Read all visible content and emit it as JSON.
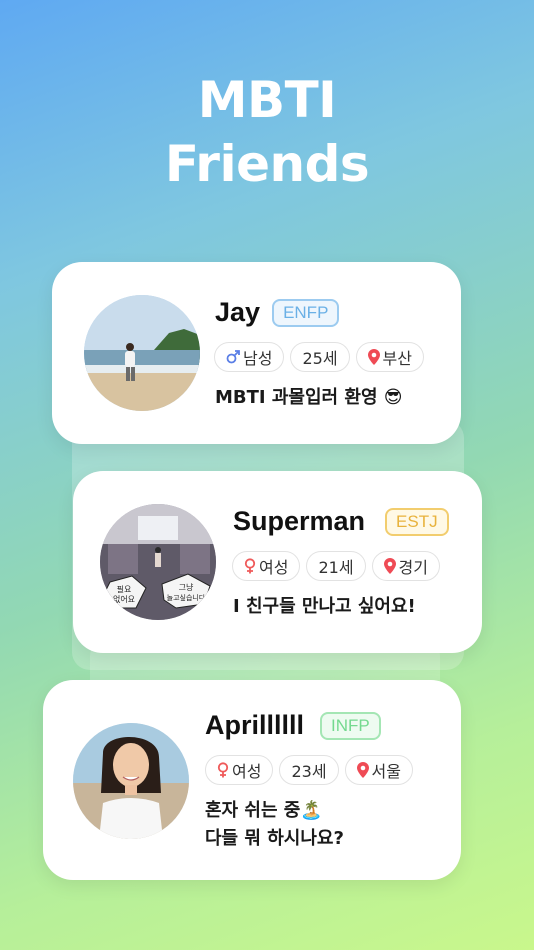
{
  "hero": {
    "line1": "MBTI",
    "line2": "Friends"
  },
  "colors": {
    "enfp": "#6ab0e6",
    "estj": "#f2c14e",
    "infp": "#74d98f",
    "male": "#5b7fe6",
    "female": "#ef5a5a",
    "location": "#ef4b55"
  },
  "profiles": [
    {
      "name": "Jay",
      "mbti": "ENFP",
      "gender": "남성",
      "gender_icon": "male-icon",
      "age": "25세",
      "location": "부산",
      "status_line1": "MBTI 과몰입러 환영 😎",
      "status_line2": ""
    },
    {
      "name": "Superman",
      "mbti": "ESTJ",
      "gender": "여성",
      "gender_icon": "female-icon",
      "age": "21세",
      "location": "경기",
      "status_line1": "I 친구들 만나고 싶어요!",
      "status_line2": "",
      "avatar_bubble_left": "필요\n없어요",
      "avatar_bubble_right": "그냥\n놀고싶습니다"
    },
    {
      "name": "Aprillllll",
      "mbti": "INFP",
      "gender": "여성",
      "gender_icon": "female-icon",
      "age": "23세",
      "location": "서울",
      "status_line1": "혼자 쉬는 중🏝️",
      "status_line2": "다들 뭐 하시나요?"
    }
  ]
}
